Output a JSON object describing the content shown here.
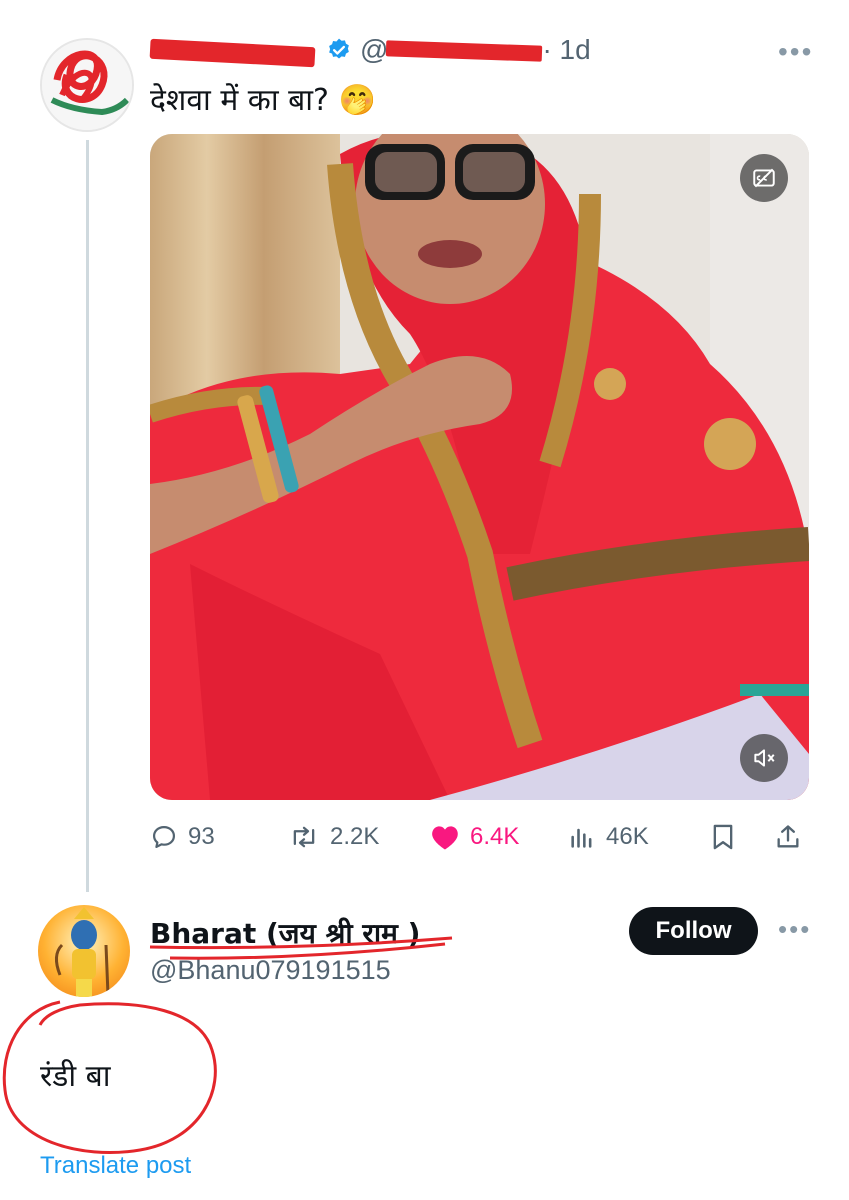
{
  "post": {
    "time": "· 1d",
    "handle_prefix": "@",
    "text": "देशवा में का बा?",
    "emoji": "🤭",
    "more": "•••",
    "stats": {
      "replies": "93",
      "reposts": "2.2K",
      "likes": "6.4K",
      "views": "46K"
    }
  },
  "reply": {
    "name": "Bharat (जय श्री राम )",
    "handle": "@Bhanu079191515",
    "follow_label": "Follow",
    "more": "•••",
    "text": "रंडी बा",
    "translate_label": "Translate post"
  },
  "colors": {
    "like": "#f91880",
    "link": "#1d9bf0",
    "verified": "#1d9bf0",
    "annotation": "#e3262b"
  },
  "icons": [
    "verified-badge-icon",
    "more-icon",
    "captions-off-icon",
    "mute-icon",
    "reply-icon",
    "repost-icon",
    "heart-icon",
    "views-icon",
    "bookmark-icon",
    "share-icon"
  ]
}
